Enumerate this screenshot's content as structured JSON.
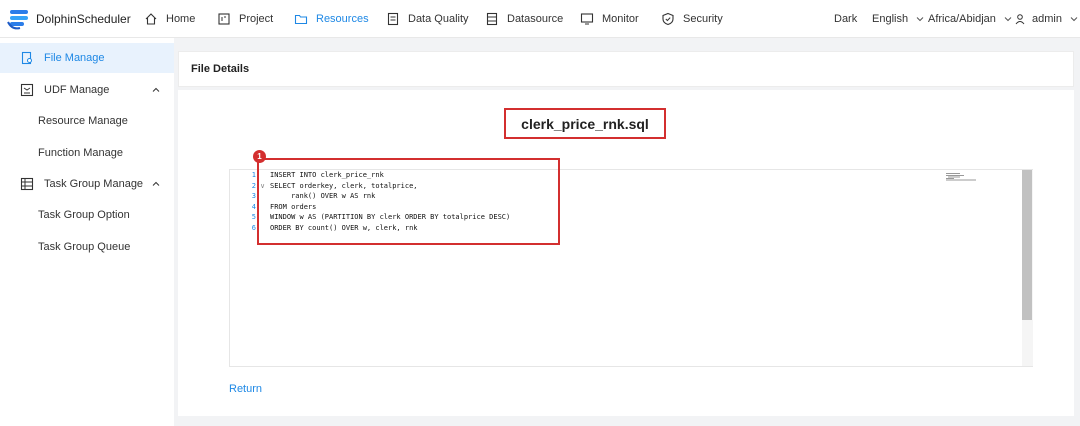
{
  "app": {
    "name": "DolphinScheduler"
  },
  "nav": {
    "home": "Home",
    "project": "Project",
    "resources": "Resources",
    "data_quality": "Data Quality",
    "datasource": "Datasource",
    "monitor": "Monitor",
    "security": "Security"
  },
  "header_right": {
    "theme": "Dark",
    "language": "English",
    "timezone": "Africa/Abidjan",
    "user": "admin"
  },
  "sidebar": {
    "file_manage": "File Manage",
    "udf_manage": "UDF Manage",
    "resource_manage": "Resource Manage",
    "function_manage": "Function Manage",
    "task_group_manage": "Task Group Manage",
    "task_group_option": "Task Group Option",
    "task_group_queue": "Task Group Queue"
  },
  "page": {
    "title": "File Details",
    "file_name": "clerk_price_rnk.sql",
    "annotation_number": "1",
    "return_label": "Return"
  },
  "editor": {
    "line_numbers": [
      "1",
      "2",
      "3",
      "4",
      "5",
      "6"
    ],
    "lines": [
      "INSERT INTO clerk_price_rnk",
      "SELECT orderkey, clerk, totalprice,",
      "     rank() OVER w AS rnk",
      "FROM orders",
      "WINDOW w AS (PARTITION BY clerk ORDER BY totalprice DESC)",
      "ORDER BY count() OVER w, clerk, rnk"
    ],
    "scroll_position": 0
  },
  "colors": {
    "accent": "#1e88e5",
    "annotation_red": "#d32f2f",
    "active_bg": "#e8f2fd"
  }
}
